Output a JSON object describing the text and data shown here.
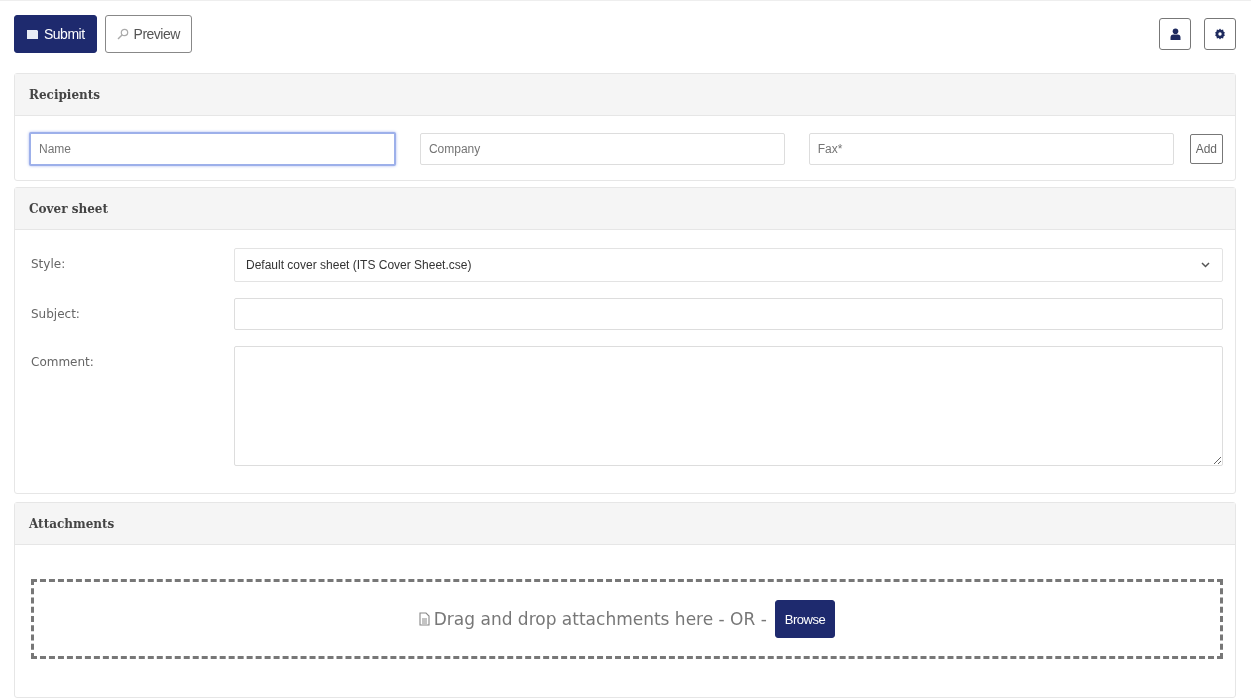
{
  "toolbar": {
    "submit": "Submit",
    "preview": "Preview"
  },
  "recipients": {
    "title": "Recipients",
    "fields": [
      {
        "placeholder": "Name",
        "focused": true
      },
      {
        "placeholder": "Company",
        "focused": false
      },
      {
        "placeholder": "Fax*",
        "focused": false
      }
    ],
    "add": "Add"
  },
  "cover_sheet": {
    "title": "Cover sheet",
    "style_label": "Style:",
    "style_value": "Default cover sheet (ITS Cover Sheet.cse)",
    "subject_label": "Subject:",
    "comment_label": "Comment:"
  },
  "attachments": {
    "title": "Attachments",
    "drop_text": "Drag and drop attachments here - OR -",
    "browse": "Browse"
  }
}
